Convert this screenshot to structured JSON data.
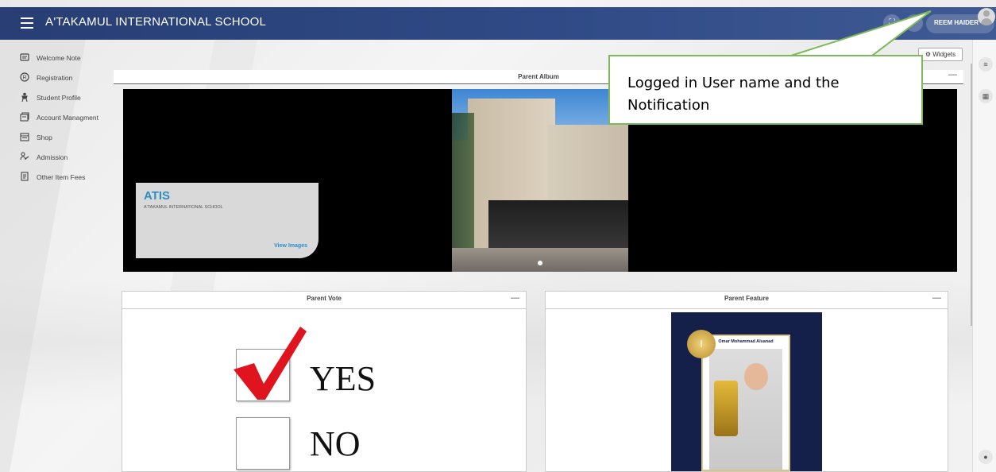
{
  "header": {
    "school_name": "A'TAKAMUL INTERNATIONAL SCHOOL",
    "user_name": "REEM HAIDER",
    "icons": [
      "menu-icon",
      "fullscreen-icon",
      "notification-icon",
      "user-avatar"
    ]
  },
  "sidebar": {
    "items": [
      {
        "label": "Welcome Note",
        "icon": "note-icon"
      },
      {
        "label": "Registration",
        "icon": "registration-icon"
      },
      {
        "label": "Student Profile",
        "icon": "student-icon"
      },
      {
        "label": "Account Managment",
        "icon": "account-icon"
      },
      {
        "label": "Shop",
        "icon": "shop-icon"
      },
      {
        "label": "Admission",
        "icon": "admission-icon"
      },
      {
        "label": "Other Item Fees",
        "icon": "fees-icon"
      }
    ]
  },
  "toolbar": {
    "widgets_label": "Widgets"
  },
  "album": {
    "title": "Parent Album",
    "card_title": "ATIS",
    "card_subtitle": "A'TAKAMUL INTERNATIONAL SCHOOL",
    "view_label": "View Images"
  },
  "vote": {
    "title": "Parent Vote",
    "yes_label": "YES",
    "no_label": "NO"
  },
  "feature": {
    "title": "Parent Feature",
    "student_name": "Omar Mohammad Alsanad"
  },
  "callout": {
    "text": "Logged in User name and the Notification"
  },
  "colors": {
    "topbar": "#283e74",
    "accent_blue": "#2b8fc6",
    "callout_border": "#7cb95a",
    "check_red": "#e0141e"
  }
}
